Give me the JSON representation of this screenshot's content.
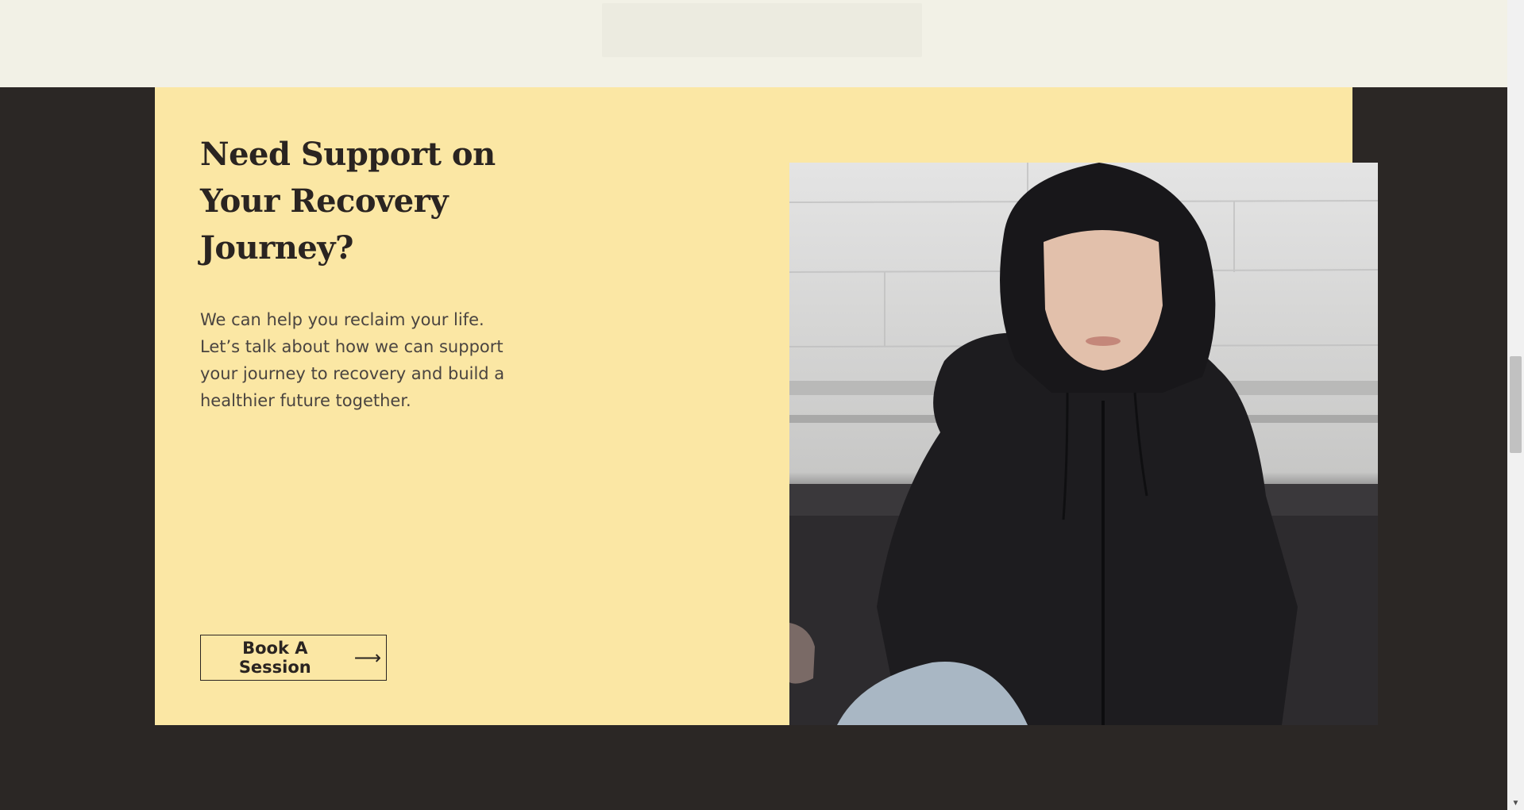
{
  "cta": {
    "title": "Need Support on Your Recovery Journey?",
    "description": "We can help you reclaim your life. Let’s talk about how we can support your journey to recovery and build a healthier future together.",
    "button_label": "Book A Session",
    "button_icon": "arrow-right-icon",
    "image_description": "Young person in a black hoodie sitting on a dark sofa with eyes closed"
  },
  "colors": {
    "card_background": "#fbe7a4",
    "page_background": "#2b2725",
    "top_band": "#f2f1e6",
    "text_dark": "#2a2421"
  }
}
